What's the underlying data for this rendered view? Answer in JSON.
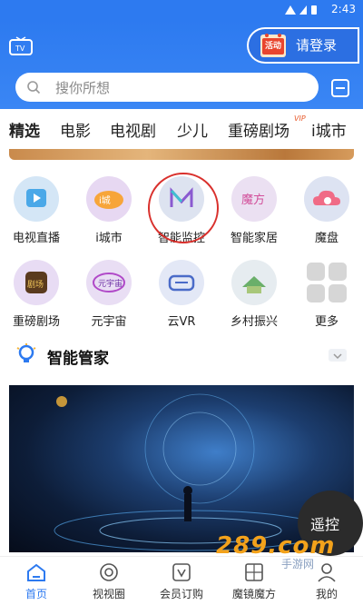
{
  "status": {
    "time": "2:43"
  },
  "header": {
    "event_badge": "活动",
    "login_label": "请登录",
    "search_placeholder": "搜你所想"
  },
  "tabs": [
    {
      "label": "精选",
      "active": true
    },
    {
      "label": "电影"
    },
    {
      "label": "电视剧"
    },
    {
      "label": "少儿"
    },
    {
      "label": "重磅剧场"
    },
    {
      "label": "i城市"
    }
  ],
  "tab_superscript": "VIP",
  "grid": [
    {
      "label": "电视直播",
      "icon": "tv-live-icon"
    },
    {
      "label": "i城市",
      "icon": "city-icon"
    },
    {
      "label": "智能监控",
      "icon": "smart-monitor-icon"
    },
    {
      "label": "智能家居",
      "icon": "smart-home-icon"
    },
    {
      "label": "魔盘",
      "icon": "cloud-drive-icon"
    },
    {
      "label": "重磅剧场",
      "icon": "theater-icon"
    },
    {
      "label": "元宇宙",
      "icon": "metaverse-icon"
    },
    {
      "label": "云VR",
      "icon": "vr-icon"
    },
    {
      "label": "乡村振兴",
      "icon": "rural-icon"
    },
    {
      "label": "更多",
      "icon": "more-grid-icon"
    }
  ],
  "butler": {
    "title": "智能管家"
  },
  "remote": {
    "label": "遥控"
  },
  "bottom_nav": [
    {
      "label": "首页",
      "icon": "home-icon",
      "active": true
    },
    {
      "label": "视视圈",
      "icon": "circle-icon"
    },
    {
      "label": "会员订购",
      "icon": "vip-icon"
    },
    {
      "label": "魔镜魔方",
      "icon": "cube-icon"
    },
    {
      "label": "我的",
      "icon": "profile-icon"
    }
  ],
  "watermark": "289.com",
  "watermark_sub": "手游网",
  "colors": {
    "accent": "#2d7af0",
    "highlight_circle": "#d9302c",
    "watermark": "#f3a21b"
  }
}
